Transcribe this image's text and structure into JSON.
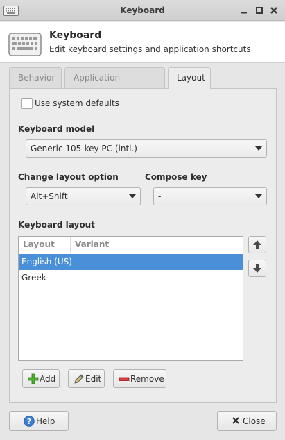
{
  "window": {
    "title": "Keyboard"
  },
  "header": {
    "title": "Keyboard",
    "subtitle": "Edit keyboard settings and application shortcuts"
  },
  "tabs": [
    {
      "label": "Behavior",
      "active": false
    },
    {
      "label": "Application Shortcuts",
      "active": false
    },
    {
      "label": "Layout",
      "active": true
    }
  ],
  "layout": {
    "use_system_defaults": {
      "label": "Use system defaults",
      "checked": false
    },
    "keyboard_model": {
      "label": "Keyboard model",
      "value": "Generic 105-key PC (intl.)"
    },
    "change_layout_option": {
      "label": "Change layout option",
      "value": "Alt+Shift"
    },
    "compose_key": {
      "label": "Compose key",
      "value": "-"
    },
    "keyboard_layout": {
      "label": "Keyboard layout",
      "columns": [
        "Layout",
        "Variant"
      ],
      "rows": [
        {
          "layout": "English (US)",
          "variant": "",
          "selected": true
        },
        {
          "layout": "Greek",
          "variant": "",
          "selected": false
        }
      ]
    },
    "buttons": {
      "add": "Add",
      "edit": "Edit",
      "remove": "Remove"
    }
  },
  "footer": {
    "help": "Help",
    "close": "Close"
  },
  "colors": {
    "selection": "#4a90d9",
    "add_icon": "#4caf2f",
    "remove_icon": "#d93a3a",
    "help_icon": "#3b7fd4"
  }
}
